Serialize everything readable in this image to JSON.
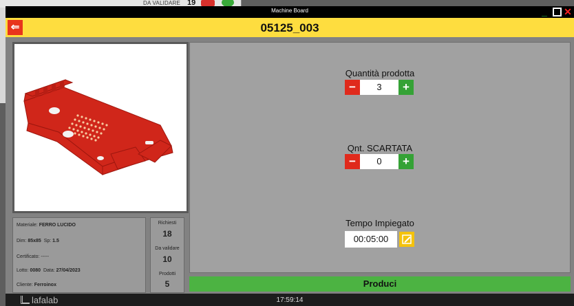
{
  "background_window": {
    "label": "DA VALIDARE",
    "count": "19"
  },
  "window": {
    "title": "Machine Board"
  },
  "header": {
    "order_code": "05125_003",
    "back_icon": "back-arrow-icon"
  },
  "colors": {
    "header_yellow": "#fedd3f",
    "minus_red": "#e02a1c",
    "plus_green": "#35a236",
    "produce_green": "#4cb342",
    "part_red": "#d0261a"
  },
  "part_info": {
    "materiale_label": "Materiale:",
    "materiale_value": "FERRO LUCIDO",
    "dim_label": "Dim:",
    "dim_value": "85x85",
    "sp_label": "Sp:",
    "sp_value": "1.5",
    "certificato_label": "Certificato:",
    "certificato_value": "-----",
    "lotto_label": "Lotto:",
    "lotto_value": "0080",
    "data_label": "Data:",
    "data_value": "27/04/2023",
    "cliente_label": "Cliente:",
    "cliente_value": "Ferroinox"
  },
  "stats": {
    "richiesti_label": "Richiesti",
    "richiesti_value": "18",
    "da_validare_label": "Da validare",
    "da_validare_value": "10",
    "prodotti_label": "Prodotti",
    "prodotti_value": "5"
  },
  "form": {
    "quantita_label": "Quantità prodotta",
    "quantita_value": "3",
    "scartata_label": "Qnt. SCARTATA",
    "scartata_value": "0",
    "tempo_label": "Tempo Impiegato",
    "tempo_value": "00:05:00",
    "minus_symbol": "−",
    "plus_symbol": "+"
  },
  "actions": {
    "produce_label": "Produci"
  },
  "statusbar": {
    "brand": "lafalab",
    "clock": "17:59:14"
  }
}
